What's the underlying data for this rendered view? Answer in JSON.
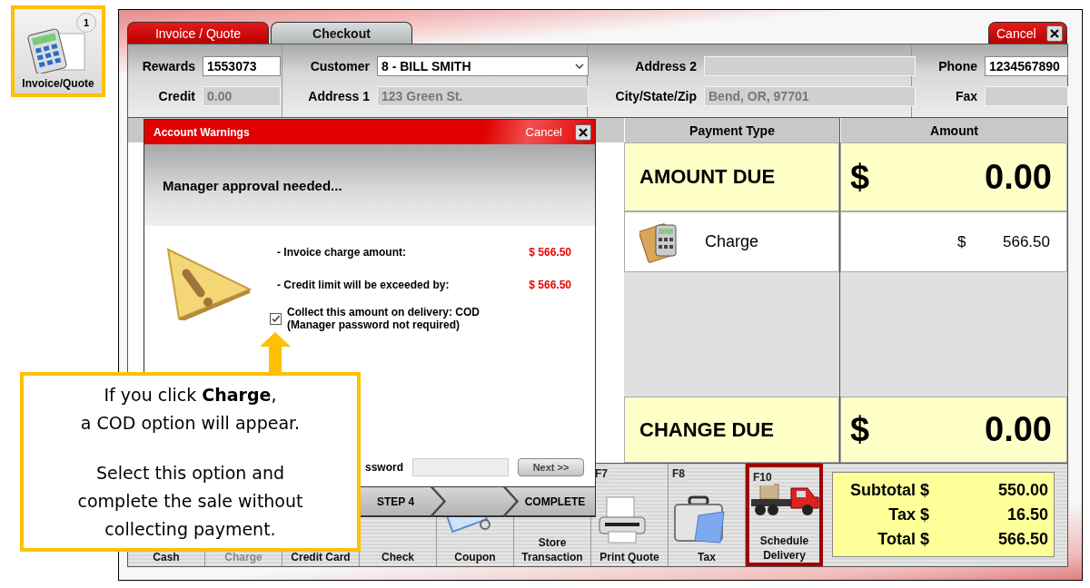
{
  "launcher": {
    "label": "Invoice/Quote",
    "badge": "1",
    "highlighted": true
  },
  "tabs": [
    {
      "label": "Invoice / Quote",
      "selected": false
    },
    {
      "label": "Checkout",
      "selected": true
    }
  ],
  "cancel_tab": {
    "label": "Cancel"
  },
  "form": {
    "sections": [
      {
        "fields": [
          {
            "kind": "text",
            "label": "Rewards",
            "value": "1553073",
            "disabled": false
          },
          {
            "kind": "text",
            "label": "Credit",
            "value": "0.00",
            "disabled": true
          }
        ]
      },
      {
        "fields": [
          {
            "kind": "dropdown",
            "label": "Customer",
            "value": "8 - BILL SMITH",
            "disabled": false
          },
          {
            "kind": "text",
            "label": "Address 1",
            "value": "123 Green St.",
            "disabled": true
          }
        ]
      },
      {
        "fields": [
          {
            "kind": "text",
            "label": "Address 2",
            "disabled": true
          },
          {
            "kind": "text",
            "label": "City/State/Zip",
            "value": "Bend, OR, 97701",
            "disabled": true
          }
        ]
      },
      {
        "fields": [
          {
            "kind": "text",
            "label": "Phone",
            "value": "1234567890",
            "disabled": false
          },
          {
            "kind": "text",
            "label": "Fax",
            "disabled": true
          }
        ]
      }
    ]
  },
  "payment_table": {
    "columns": [
      "Payment Type",
      "Amount"
    ],
    "rows": [
      {
        "kind": "total",
        "label": "AMOUNT DUE",
        "currency": "$",
        "amount": "0.00"
      },
      {
        "kind": "payment",
        "label": "Charge",
        "currency": "$",
        "amount": "566.50"
      },
      {
        "kind": "total",
        "label": "CHANGE DUE",
        "currency": "$",
        "amount": "0.00"
      }
    ]
  },
  "function_buttons": [
    {
      "label": "Cash",
      "disabled": false,
      "highlighted": false
    },
    {
      "label": "Charge",
      "disabled": true,
      "highlighted": false
    },
    {
      "label": "Credit Card",
      "disabled": false,
      "highlighted": false
    },
    {
      "label": "Check",
      "disabled": false,
      "highlighted": false
    },
    {
      "label": "Coupon",
      "disabled": false,
      "highlighted": false
    },
    {
      "label": "Store Transaction",
      "disabled": false,
      "highlighted": false
    },
    {
      "label": "Print Quote",
      "key": "F7",
      "disabled": false,
      "highlighted": false
    },
    {
      "label": "Tax",
      "key": "F8",
      "disabled": false,
      "highlighted": false
    },
    {
      "label": "Schedule Delivery",
      "key": "F10",
      "disabled": false,
      "highlighted": true
    }
  ],
  "totals": [
    {
      "label": "Subtotal $",
      "value": "550.00"
    },
    {
      "label": "Tax $",
      "value": "16.50"
    },
    {
      "label": "Total $",
      "value": "566.50"
    }
  ],
  "dialog": {
    "title": "Account Warnings",
    "cancel": "Cancel",
    "heading": "Manager approval needed...",
    "lines": [
      {
        "label": "- Invoice charge amount:",
        "amount": "$ 566.50"
      },
      {
        "label": "- Credit limit will be exceeded by:",
        "amount": "$ 566.50"
      }
    ],
    "cod_option": {
      "label": "Collect this amount on delivery: COD\n(Manager password not required)",
      "checked": true
    },
    "password": {
      "label": "ssword"
    },
    "next_button": "Next >>",
    "steps": [
      {
        "kind": "step",
        "label": "STEP 4"
      },
      {
        "kind": "blank"
      },
      {
        "kind": "step",
        "label": "COMPLETE"
      }
    ]
  },
  "callout": {
    "paragraphs": [
      "If you click **Charge**,\na COD option will appear.",
      "Select this option and complete the sale without collecting payment."
    ]
  }
}
